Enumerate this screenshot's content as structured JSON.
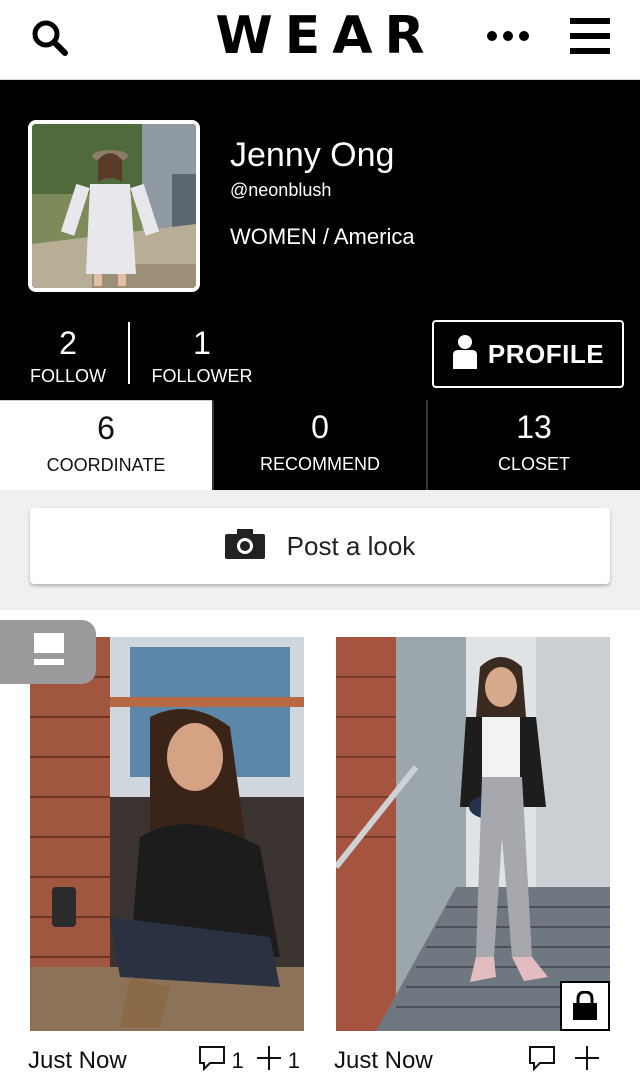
{
  "header": {
    "logo_text": "WEAR",
    "icons": [
      "search-icon",
      "more-icon",
      "menu-icon"
    ]
  },
  "profile": {
    "name": "Jenny Ong",
    "handle": "@neonblush",
    "category": "WOMEN / America",
    "follow_count": "2",
    "follow_label": "FOLLOW",
    "follower_count": "1",
    "follower_label": "FOLLOWER",
    "profile_button_label": "PROFILE"
  },
  "tabs": [
    {
      "count": "6",
      "label": "COORDINATE",
      "active": true
    },
    {
      "count": "0",
      "label": "RECOMMEND",
      "active": false
    },
    {
      "count": "13",
      "label": "CLOSET",
      "active": false
    }
  ],
  "post": {
    "button_label": "Post a look"
  },
  "feed": [
    {
      "time": "Just Now",
      "comments": "1",
      "adds": "1",
      "locked": false
    },
    {
      "time": "Just Now",
      "comments": "",
      "adds": "",
      "locked": true
    }
  ],
  "colors": {
    "header_bg": "#000000",
    "accent_text": "#ffffff",
    "page_bg": "#f0f0f0",
    "toggle_bg": "#9a9a9a"
  }
}
